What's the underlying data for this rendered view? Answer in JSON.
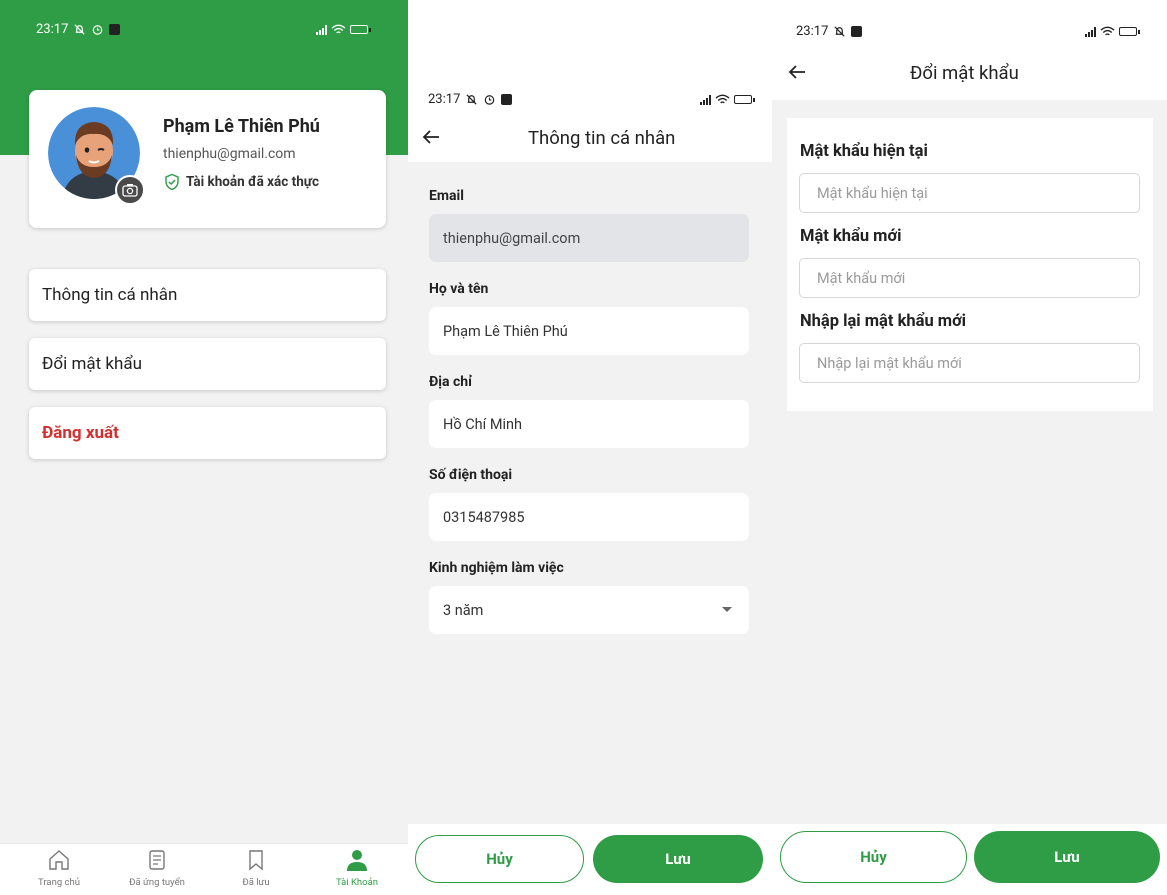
{
  "status_bar": {
    "time": "23:17",
    "status_icons": [
      "muted-bell-icon",
      "alarm-icon",
      "notification-icon",
      "signal-icon",
      "wifi-icon",
      "battery-icon"
    ]
  },
  "account_screen": {
    "profile": {
      "name": "Phạm Lê Thiên Phú",
      "email": "thienphu@gmail.com",
      "verified_label": "Tài khoản đã xác thực"
    },
    "menu": [
      {
        "label": "Thông tin cá nhân"
      },
      {
        "label": "Đổi mật khẩu"
      },
      {
        "label": "Đăng xuất"
      }
    ],
    "bottom_nav": [
      {
        "label": "Trang chủ",
        "icon": "home-icon"
      },
      {
        "label": "Đã ứng tuyển",
        "icon": "document-icon"
      },
      {
        "label": "Đã lưu",
        "icon": "bookmark-icon"
      },
      {
        "label": "Tài Khoản",
        "icon": "user-icon",
        "active": true
      }
    ],
    "colors": {
      "brand": "#2e9d46",
      "logout": "#d32f2f"
    }
  },
  "personal_info_screen": {
    "title": "Thông tin cá nhân",
    "fields": {
      "email": {
        "label": "Email",
        "value": "thienphu@gmail.com"
      },
      "fullname": {
        "label": "Họ và tên",
        "value": "Phạm Lê Thiên Phú"
      },
      "address": {
        "label": "Địa chỉ",
        "value": "Hồ Chí Minh"
      },
      "phone": {
        "label": "Số điện thoại",
        "value": "0315487985"
      },
      "experience": {
        "label": "Kinh nghiệm làm việc",
        "value": "3 năm"
      }
    },
    "buttons": {
      "cancel": "Hủy",
      "save": "Lưu"
    }
  },
  "change_password_screen": {
    "title": "Đổi mật khẩu",
    "fields": {
      "current": {
        "label": "Mật khẩu hiện tại",
        "placeholder": "Mật khẩu hiện tại"
      },
      "new": {
        "label": "Mật khẩu mới",
        "placeholder": "Mật khẩu mới"
      },
      "confirm": {
        "label": "Nhập lại mật khẩu mới",
        "placeholder": "Nhập lại mật khẩu mới"
      }
    },
    "buttons": {
      "cancel": "Hủy",
      "save": "Lưu"
    }
  }
}
